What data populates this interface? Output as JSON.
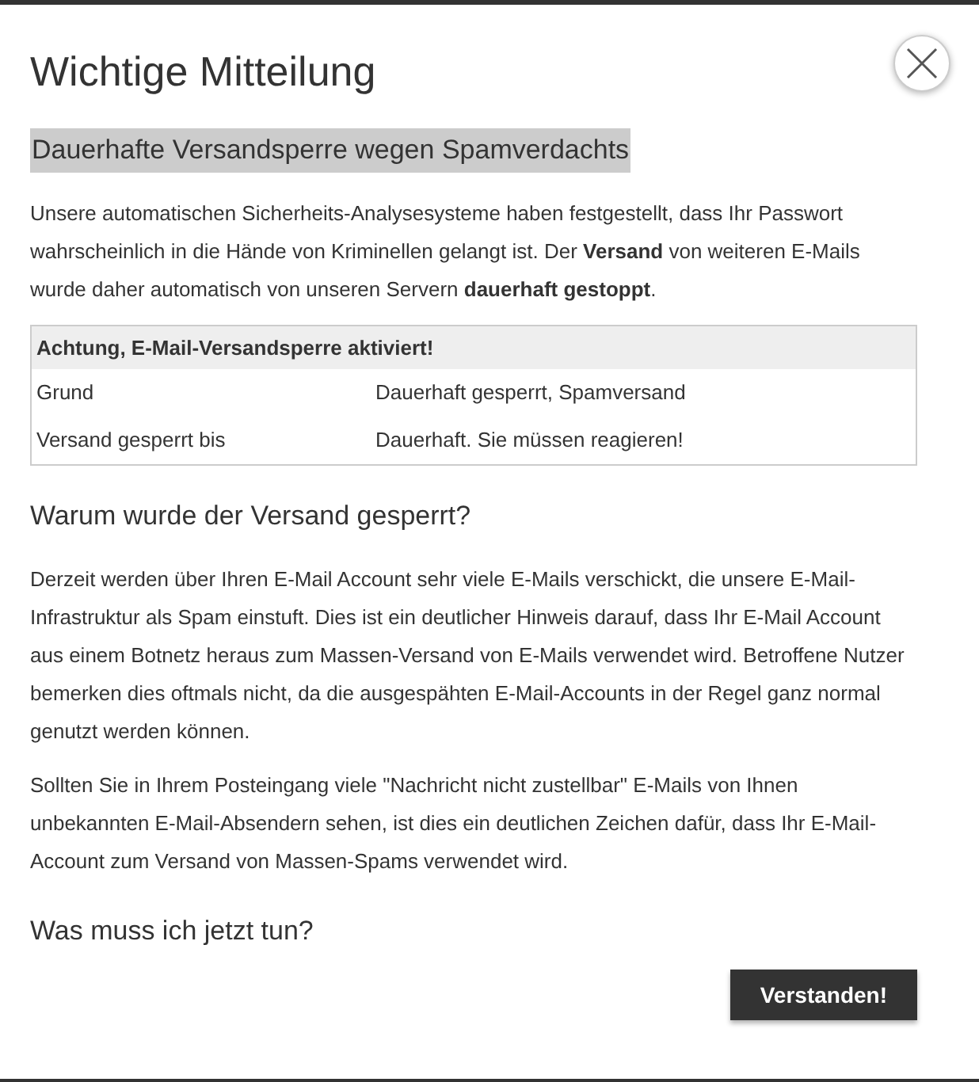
{
  "dialog": {
    "title": "Wichtige Mitteilung"
  },
  "highlight_heading": "Dauerhafte Versandsperre wegen Spamverdachts",
  "intro": "Unsere automatischen Sicherheits-Analysesysteme haben festgestellt, dass Ihr Passwort wahrscheinlich in die Hände von Kriminellen gelangt ist. Der **Versand** von weiteren E-Mails wurde daher automatisch von unseren Servern **dauerhaft gestoppt**.",
  "table": {
    "header": "Achtung, E-Mail-Versandsperre aktiviert!",
    "rows": [
      {
        "label": "Grund",
        "value": "Dauerhaft gesperrt, Spamversand"
      },
      {
        "label": "Versand gesperrt bis",
        "value": "Dauerhaft. Sie müssen reagieren!"
      }
    ]
  },
  "sections": [
    {
      "heading": "Warum wurde der Versand gesperrt?",
      "paragraphs": [
        "Derzeit werden über Ihren E-Mail Account sehr viele E-Mails verschickt, die unsere E-Mail-Infrastruktur als Spam einstuft. Dies ist ein deutlicher Hinweis darauf, dass Ihr E-Mail Account aus einem Botnetz heraus zum Massen-Versand von E-Mails verwendet wird. Betroffene Nutzer bemerken dies oftmals nicht, da die ausgespähten E-Mail-Accounts in der Regel ganz normal genutzt werden können.",
        "Sollten Sie in Ihrem Posteingang viele \"Nachricht nicht zustellbar\" E-Mails von Ihnen unbekannten E-Mail-Absendern sehen, ist dies ein deutlichen Zeichen dafür, dass Ihr E-Mail-Account zum Versand von Massen-Spams verwendet wird."
      ]
    },
    {
      "heading": "Was muss ich jetzt tun?"
    }
  ],
  "button": "Verstanden!"
}
